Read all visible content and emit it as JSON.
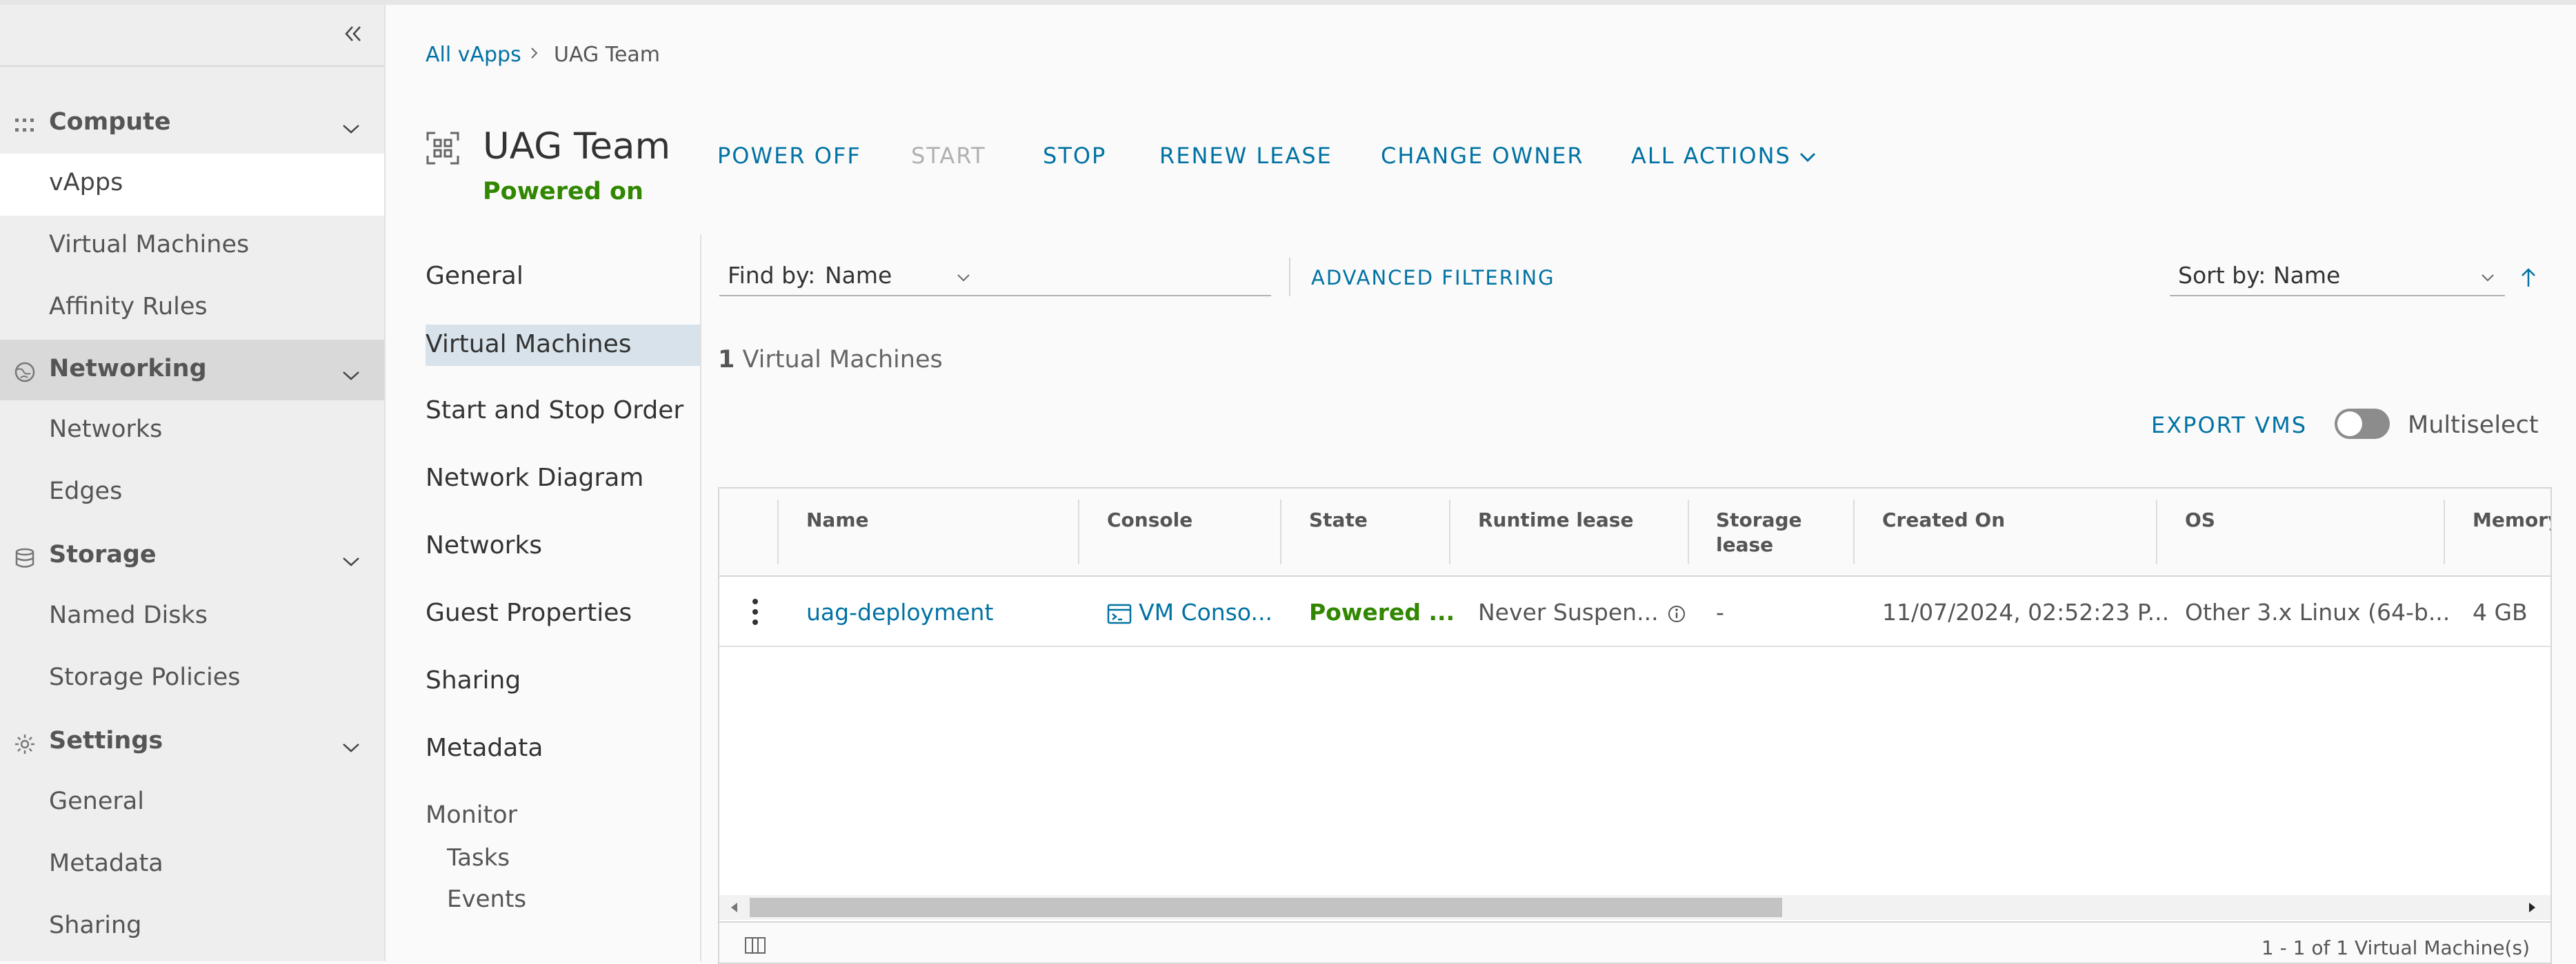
{
  "sidebar": {
    "sections": [
      {
        "label": "Compute",
        "icon": "grid-icon",
        "items": [
          "vApps",
          "Virtual Machines",
          "Affinity Rules"
        ]
      },
      {
        "label": "Networking",
        "icon": "network-icon",
        "items": [
          "Networks",
          "Edges"
        ]
      },
      {
        "label": "Storage",
        "icon": "database-icon",
        "items": [
          "Named Disks",
          "Storage Policies"
        ]
      },
      {
        "label": "Settings",
        "icon": "gear-icon",
        "items": [
          "General",
          "Metadata",
          "Sharing"
        ]
      }
    ],
    "selected_item": "vApps",
    "active_section": "Networking"
  },
  "breadcrumb": {
    "parent": "All vApps",
    "current": "UAG Team"
  },
  "header": {
    "title": "UAG Team",
    "status": "Powered on",
    "actions": {
      "power_off": "POWER OFF",
      "start": "START",
      "stop": "STOP",
      "renew_lease": "RENEW LEASE",
      "change_owner": "CHANGE OWNER",
      "all_actions": "ALL ACTIONS"
    }
  },
  "subnav": {
    "items": [
      "General",
      "Virtual Machines",
      "Start and Stop Order",
      "Network Diagram",
      "Networks",
      "Guest Properties",
      "Sharing",
      "Metadata"
    ],
    "selected": "Virtual Machines",
    "monitor": {
      "label": "Monitor",
      "items": [
        "Tasks",
        "Events"
      ]
    }
  },
  "filters": {
    "find_by_label": "Find by:",
    "find_by_value": "Name",
    "advanced_filtering": "ADVANCED FILTERING",
    "sort_by_label": "Sort by:",
    "sort_by_value": "Name"
  },
  "vm_count": {
    "number": "1",
    "label": "Virtual Machines"
  },
  "toolbar": {
    "export_label": "EXPORT VMS",
    "multiselect_label": "Multiselect",
    "multiselect_on": false
  },
  "table": {
    "columns": [
      "Name",
      "Console",
      "State",
      "Runtime lease",
      "Storage\nlease",
      "Created On",
      "OS",
      "Memory"
    ],
    "rows": [
      {
        "name": "uag-deployment",
        "console": "VM Conso...",
        "state": "Powered ...",
        "runtime_lease": "Never Suspen...",
        "storage_lease": "-",
        "created_on": "11/07/2024, 02:52:23 P...",
        "os": "Other 3.x Linux (64-b...",
        "memory": "4 GB"
      }
    ],
    "footer": "1 - 1 of 1 Virtual Machine(s)"
  },
  "colors": {
    "accent": "#0072a3",
    "success": "#318700"
  }
}
